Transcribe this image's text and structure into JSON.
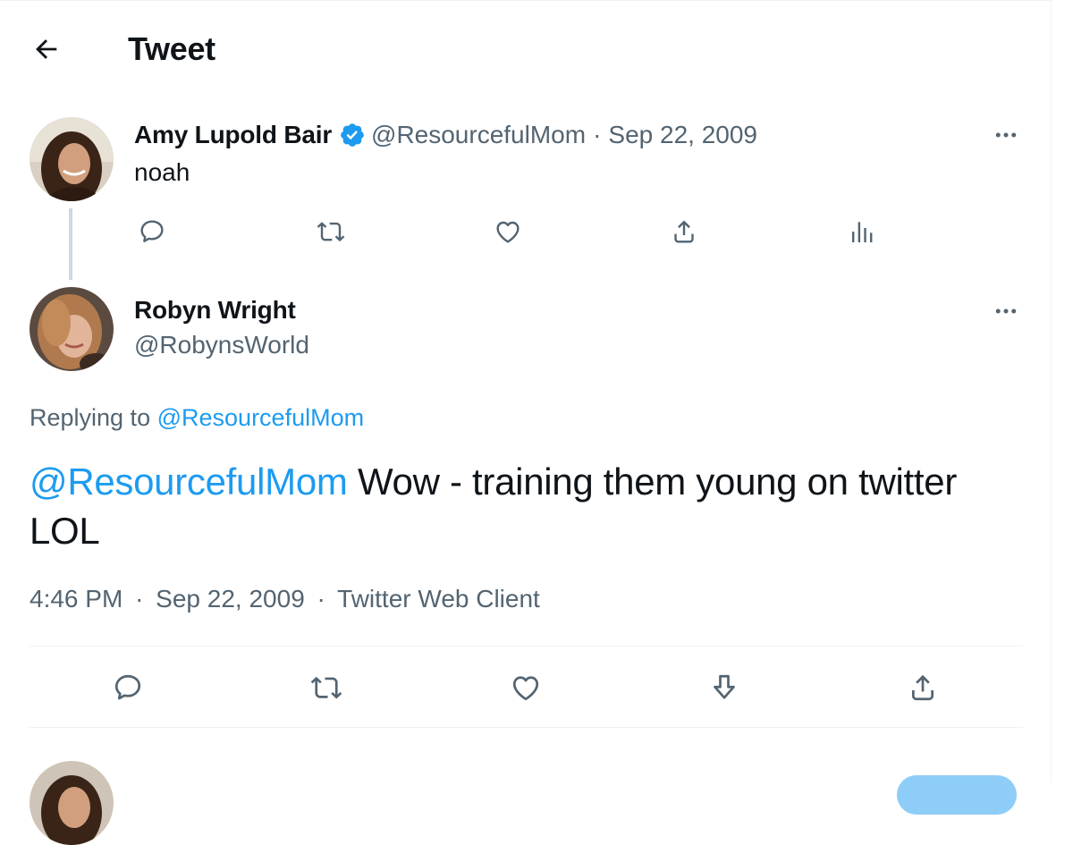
{
  "header": {
    "title": "Tweet",
    "back_icon": "arrow-left-icon"
  },
  "parent_tweet": {
    "name": "Amy Lupold Bair",
    "verified": true,
    "handle": "@ResourcefulMom",
    "separator": "·",
    "date": "Sep 22, 2009",
    "text": "noah",
    "actions": [
      "reply-icon",
      "retweet-icon",
      "like-icon",
      "share-icon",
      "analytics-icon"
    ]
  },
  "main_tweet": {
    "name": "Robyn Wright",
    "handle": "@RobynsWorld",
    "replying_prefix": "Replying to",
    "replying_to": "@ResourcefulMom",
    "mention": "@ResourcefulMom",
    "text": " Wow - training them young on twitter LOL",
    "time": "4:46 PM",
    "date": "Sep 22, 2009",
    "source": "Twitter Web Client",
    "separator": "·",
    "actions": [
      "reply-icon",
      "retweet-icon",
      "like-icon",
      "bookmark-icon",
      "share-icon"
    ]
  },
  "colors": {
    "accent": "#1d9bf0",
    "muted": "#536471",
    "text": "#0f1419",
    "divider": "#eff3f4"
  }
}
